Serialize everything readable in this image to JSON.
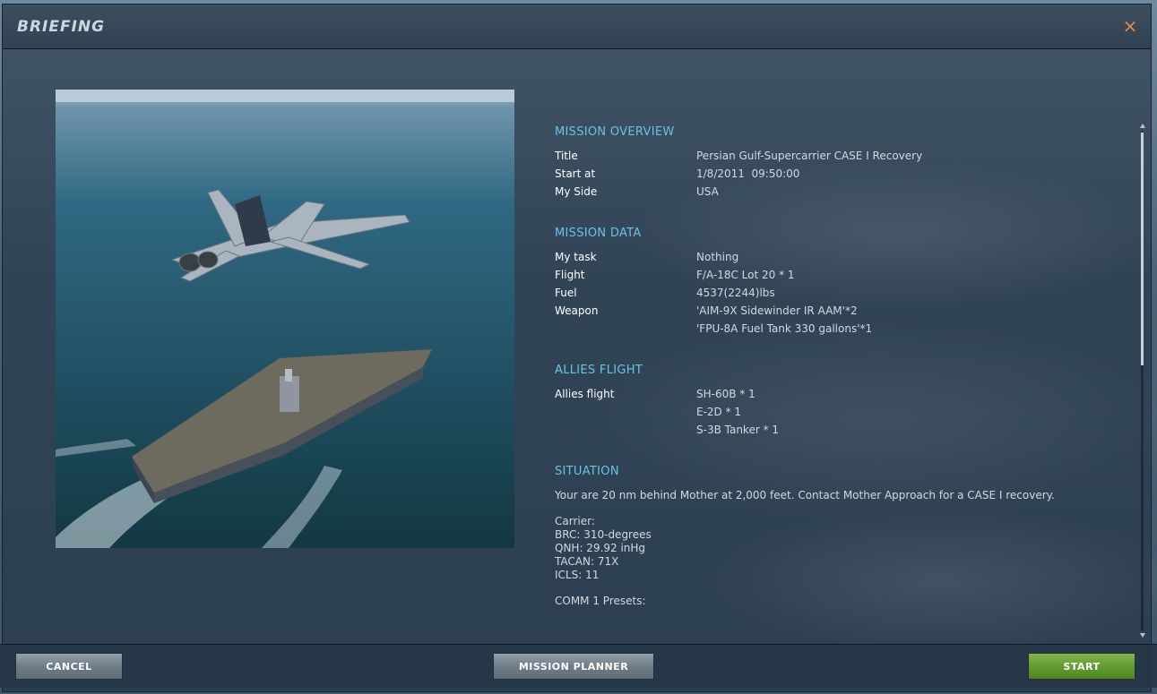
{
  "window": {
    "title": "BRIEFING",
    "close_glyph": "×"
  },
  "image": {
    "icon": "mission-preview-image"
  },
  "overview": {
    "heading": "MISSION OVERVIEW",
    "rows": [
      {
        "label": "Title",
        "value": "Persian Gulf-Supercarrier CASE I Recovery"
      },
      {
        "label": "Start at",
        "value": "1/8/2011  09:50:00"
      },
      {
        "label": "My Side",
        "value": "USA"
      }
    ]
  },
  "mission_data": {
    "heading": "MISSION DATA",
    "rows": [
      {
        "label": "My task",
        "value": "Nothing"
      },
      {
        "label": "Flight",
        "value": "F/A-18C Lot 20 * 1"
      },
      {
        "label": "Fuel",
        "value": "4537(2244)lbs"
      }
    ],
    "weapon_label": "Weapon",
    "weapons": [
      "'AIM-9X Sidewinder IR AAM'*2",
      "'FPU-8A Fuel Tank 330 gallons'*1"
    ]
  },
  "allies": {
    "heading": "ALLIES FLIGHT",
    "label": "Allies flight",
    "values": [
      "SH-60B * 1",
      "E-2D * 1",
      "S-3B Tanker * 1"
    ]
  },
  "situation": {
    "heading": "SITUATION",
    "intro": "Your are 20 nm behind Mother at 2,000 feet. Contact Mother Approach for a CASE I recovery.",
    "carrier_lines": [
      "Carrier:",
      "BRC: 310-degrees",
      "QNH: 29.92 inHg",
      "TACAN: 71X",
      "ICLS: 11"
    ],
    "comm": "COMM 1 Presets:"
  },
  "footer": {
    "cancel_label": "CANCEL",
    "planner_label": "MISSION PLANNER",
    "start_label": "START"
  },
  "colors": {
    "accent": "#67c3e8",
    "close": "#e58a44",
    "start_button": "#5f9a2f"
  }
}
